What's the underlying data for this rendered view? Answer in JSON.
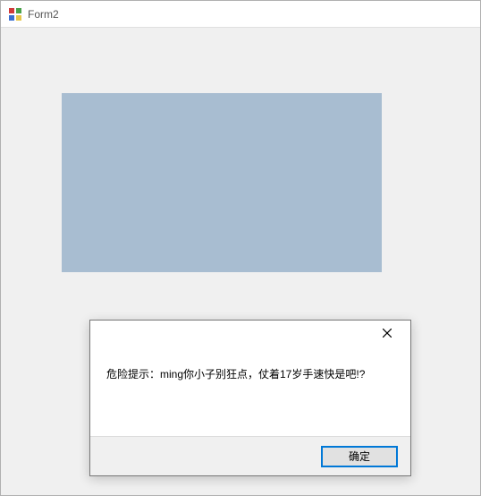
{
  "window": {
    "title": "Form2"
  },
  "dialog": {
    "message": "危险提示：ming你小子别狂点，仗着17岁手速快是吧!?",
    "ok_label": "确定"
  }
}
